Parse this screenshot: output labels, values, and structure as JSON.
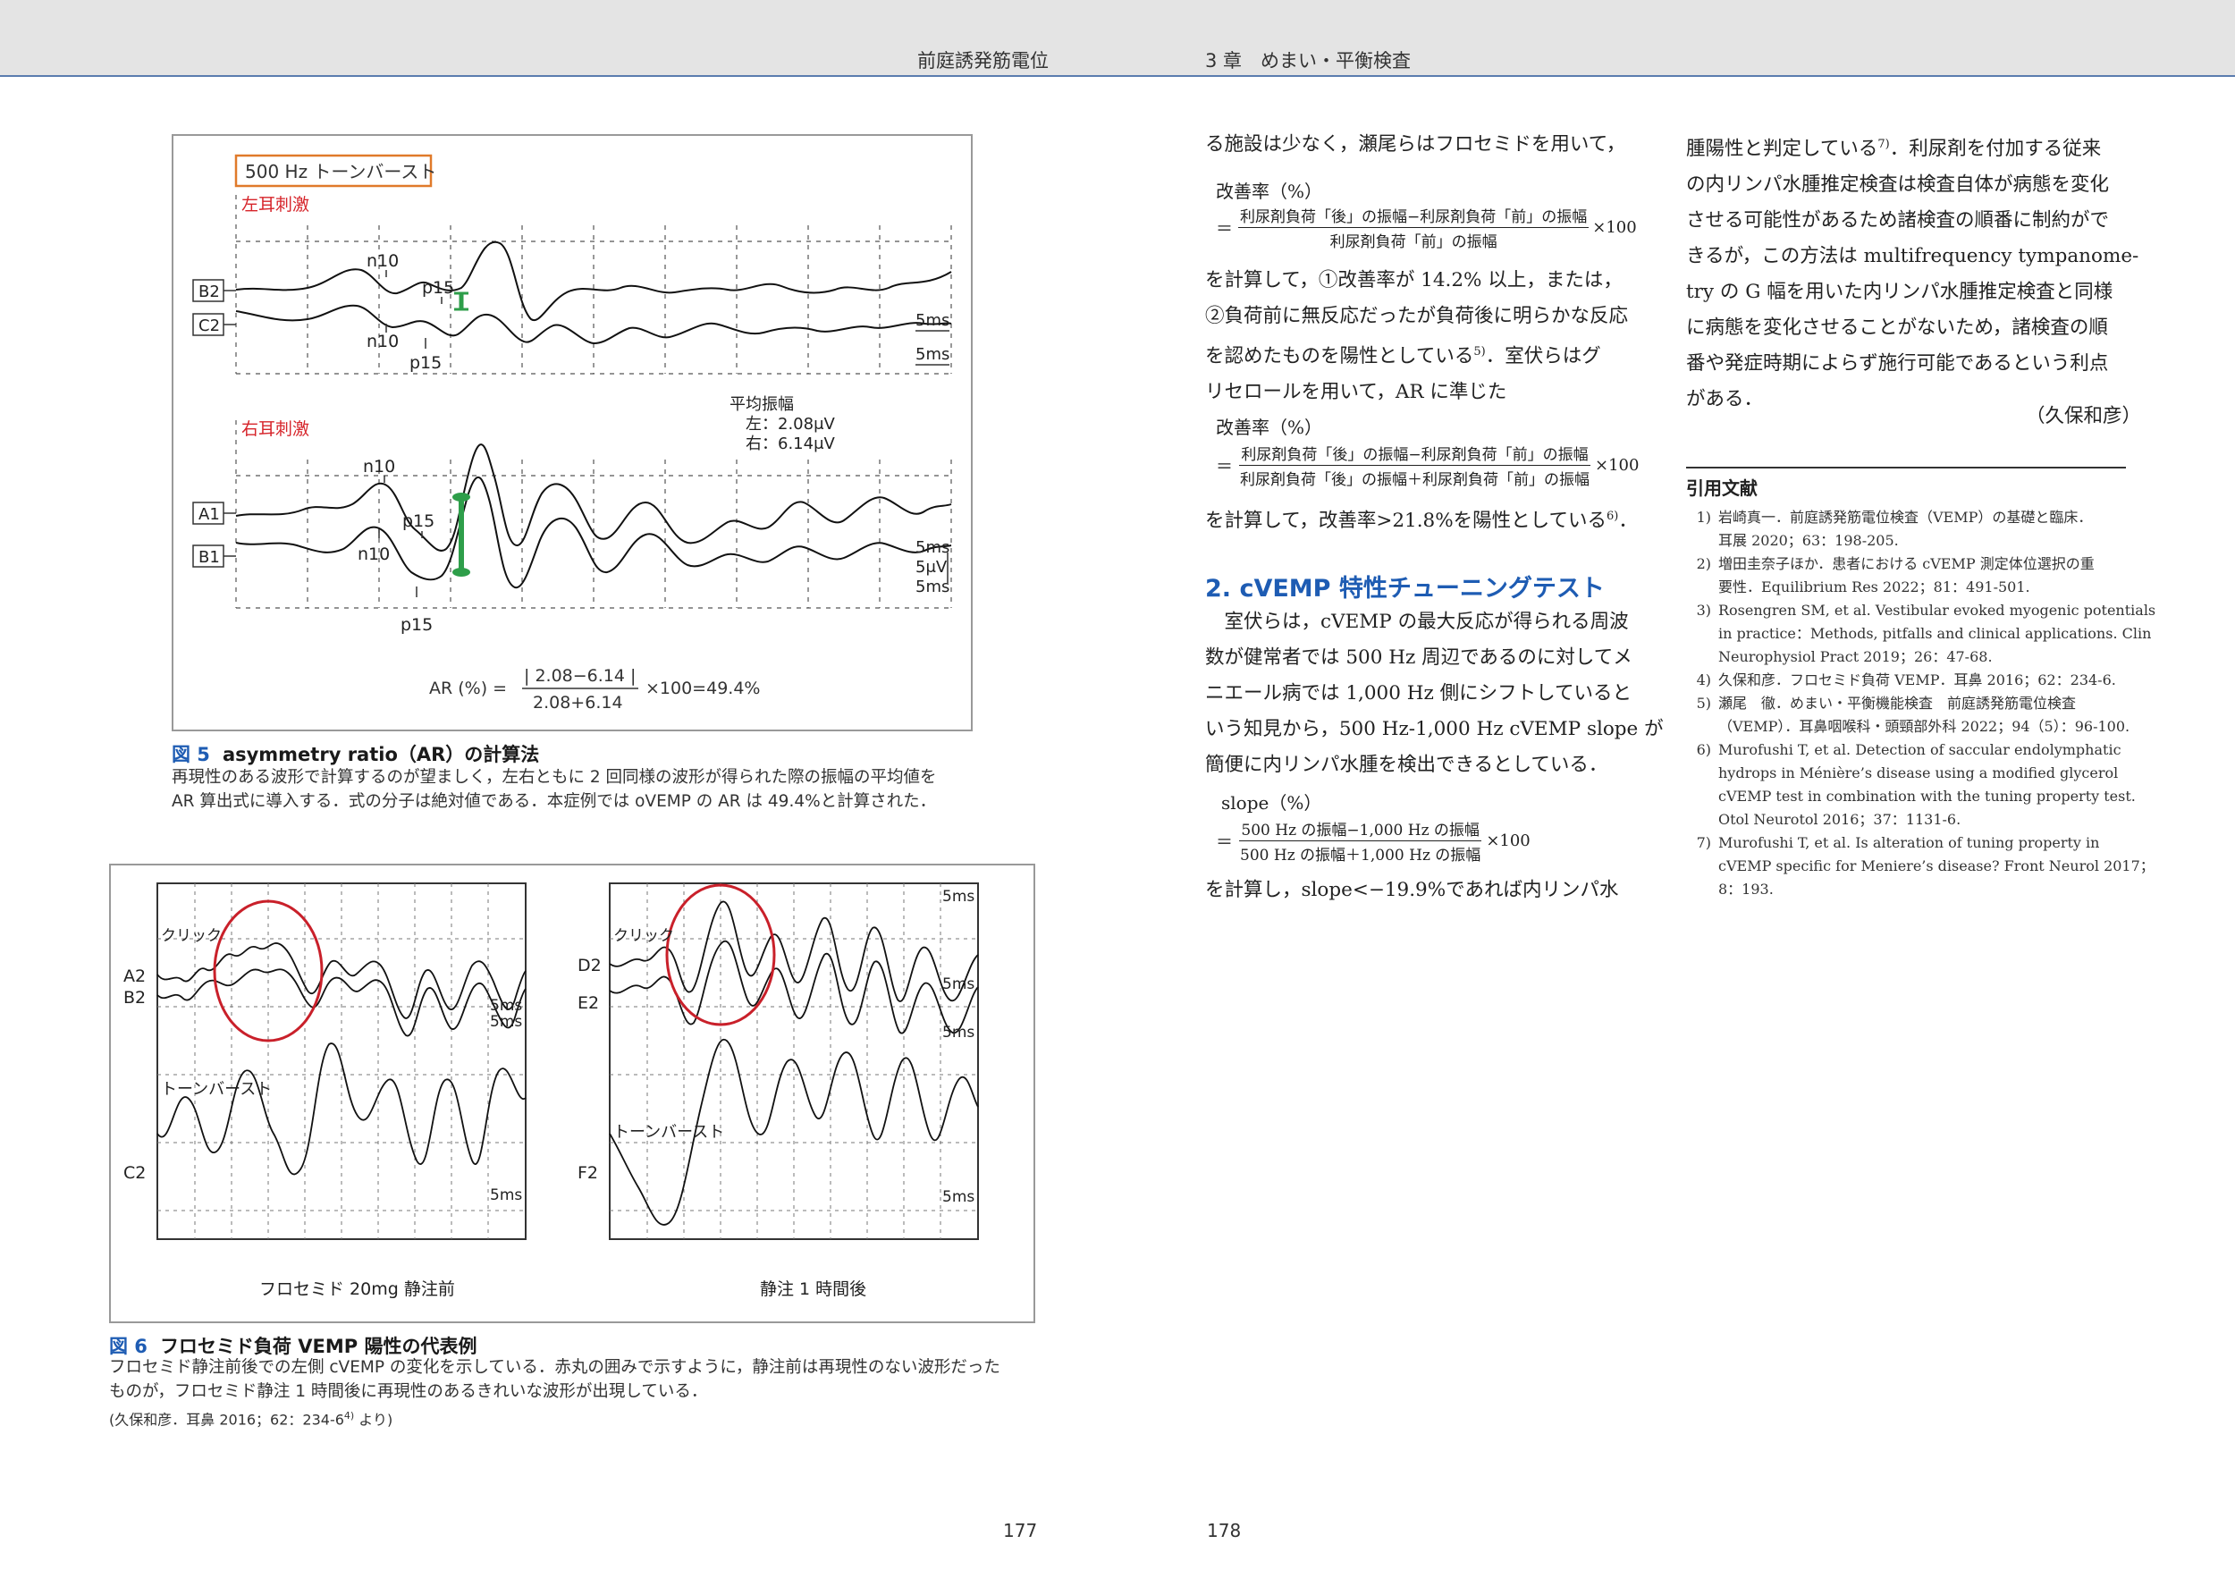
{
  "header": {
    "left_running_title": "前庭誘発筋電位",
    "right_running_title": "3 章　めまい・平衡検査"
  },
  "page_numbers": {
    "left": "177",
    "right": "178"
  },
  "figure5": {
    "badge": "500 Hz トーンバースト",
    "left_stim": "左耳刺激",
    "right_stim": "右耳刺激",
    "row_labels": [
      "B2",
      "C2",
      "A1",
      "B1"
    ],
    "peak_n10": "n10",
    "peak_p15": "p15",
    "scale_5ms": "5ms",
    "scale_5uv": "5μV",
    "avg_title": "平均振幅",
    "avg_left": "左：2.08μV",
    "avg_right": "右：6.14μV",
    "ar_lhs": "AR (%) =",
    "ar_num": "| 2.08−6.14 |",
    "ar_den": "2.08+6.14",
    "ar_rhs": "×100=49.4%",
    "caption_num": "図 5",
    "caption_title": "asymmetry ratio（AR）の計算法",
    "caption_lines": [
      "再現性のある波形で計算するのが望ましく，左右ともに 2 回同様の波形が得られた際の振幅の平均値を",
      "AR 算出式に導入する．式の分子は絶対値である．本症例では oVEMP の AR は 49.4%と計算された．"
    ]
  },
  "figure6": {
    "left_panel": {
      "rows_top": [
        "A2",
        "B2"
      ],
      "row_bottom": "C2",
      "click": "クリック",
      "tone": "トーンバースト",
      "scale": "5ms",
      "footer": "フロセミド 20mg 静注前"
    },
    "right_panel": {
      "rows_top": [
        "D2",
        "E2"
      ],
      "row_bottom": "F2",
      "click": "クリック",
      "tone": "トーンバースト",
      "scale": "5ms",
      "footer": "静注 1 時間後"
    },
    "caption_num": "図 6",
    "caption_title": "フロセミド負荷 VEMP 陽性の代表例",
    "caption_lines": [
      "フロセミド静注前後での左側 cVEMP の変化を示している．赤丸の囲みで示すように，静注前は再現性のない波形だった",
      "ものが，フロセミド静注 1 時間後に再現性のあるきれいな波形が出現している．"
    ],
    "source": "(久保和彦．耳鼻 2016；62：234-6",
    "source_sup": "4)",
    "source_tail": " より)"
  },
  "col1": {
    "line1": "る施設は少なく，瀬尾らはフロセミドを用いて，",
    "f1_label": "改善率（%）",
    "f1_num": "利尿剤負荷「後」の振幅−利尿剤負荷「前」の振幅",
    "f1_den": "利尿剤負荷「前」の振幅",
    "mul100": "×100",
    "eq": "＝",
    "para2": [
      "を計算して，①改善率が 14.2% 以上，または，",
      "②負荷前に無反応だったが負荷後に明らかな反応",
      "を認めたものを陽性としている",
      "．室伏らはグ",
      "リセロールを用いて，AR に準じた"
    ],
    "para2_sup": "5)",
    "f2_label": "改善率（%）",
    "f2_num": "利尿剤負荷「後」の振幅−利尿剤負荷「前」の振幅",
    "f2_den": "利尿剤負荷「後」の振幅＋利尿剤負荷「前」の振幅",
    "line_after_f2": "を計算して，改善率>21.8%を陽性としている",
    "line_after_f2_sup": "6)",
    "line_after_f2_tail": "．",
    "section_heading": "2.  cVEMP 特性チューニングテスト",
    "para3": [
      "　室伏らは，cVEMP の最大反応が得られる周波",
      "数が健常者では 500 Hz 周辺であるのに対してメ",
      "ニエール病では 1,000 Hz 側にシフトしていると",
      "いう知見から，500 Hz-1,000 Hz cVEMP slope が",
      "簡便に内リンパ水腫を検出できるとしている．"
    ],
    "f3_label": "slope（%）",
    "f3_num": "500 Hz の振幅−1,000 Hz の振幅",
    "f3_den": "500 Hz の振幅＋1,000 Hz の振幅",
    "last_line": "を計算し，slope<−19.9%であれば内リンパ水"
  },
  "col2": {
    "line1_a": "腫陽性と判定している",
    "line1_sup": "7)",
    "line1_b": "．利尿剤を付加する従来",
    "lines": [
      "の内リンパ水腫推定検査は検査自体が病態を変化",
      "させる可能性があるため諸検査の順番に制約がで",
      "きるが，この方法は multifrequency tympanome-",
      "try の G 幅を用いた内リンパ水腫推定検査と同様",
      "に病態を変化させることがないため，諸検査の順",
      "番や発症時期によらず施行可能であるという利点",
      "がある．"
    ],
    "author": "（久保和彦）",
    "refs_heading": "引用文献",
    "refs": [
      {
        "n": "1)",
        "lines": [
          "岩崎真一．前庭誘発筋電位検査（VEMP）の基礎と臨床．",
          "耳展 2020；63：198-205."
        ]
      },
      {
        "n": "2)",
        "lines": [
          "増田圭奈子ほか．患者における cVEMP 測定体位選択の重",
          "要性．Equilibrium Res 2022；81：491-501."
        ]
      },
      {
        "n": "3)",
        "lines": [
          "Rosengren SM, et al. Vestibular evoked myogenic potentials",
          "in practice：Methods, pitfalls and clinical applications. Clin",
          "Neurophysiol Pract 2019；26：47-68."
        ]
      },
      {
        "n": "4)",
        "lines": [
          "久保和彦．フロセミド負荷 VEMP．耳鼻 2016；62：234-6."
        ]
      },
      {
        "n": "5)",
        "lines": [
          "瀬尾　徹．めまい・平衡機能検査　前庭誘発筋電位検査",
          "（VEMP）．耳鼻咽喉科・頭頸部外科 2022；94（5）：96-100."
        ]
      },
      {
        "n": "6)",
        "lines": [
          "Murofushi T, et al. Detection of saccular endolymphatic",
          "hydrops in Ménière’s disease using a modified glycerol",
          "cVEMP test in combination with the tuning property test.",
          "Otol Neurotol 2016；37：1131-6."
        ]
      },
      {
        "n": "7)",
        "lines": [
          "Murofushi T, et al. Is alteration of tuning property in",
          "cVEMP specific for Meniere’s disease? Front Neurol 2017；",
          "8：193."
        ]
      }
    ]
  },
  "colors": {
    "accent_blue": "#1e5cb3",
    "badge_orange": "#e07a2a",
    "stim_red": "#d6242a",
    "marker_green": "#2e9e4a",
    "circle_red": "#c9202a"
  }
}
